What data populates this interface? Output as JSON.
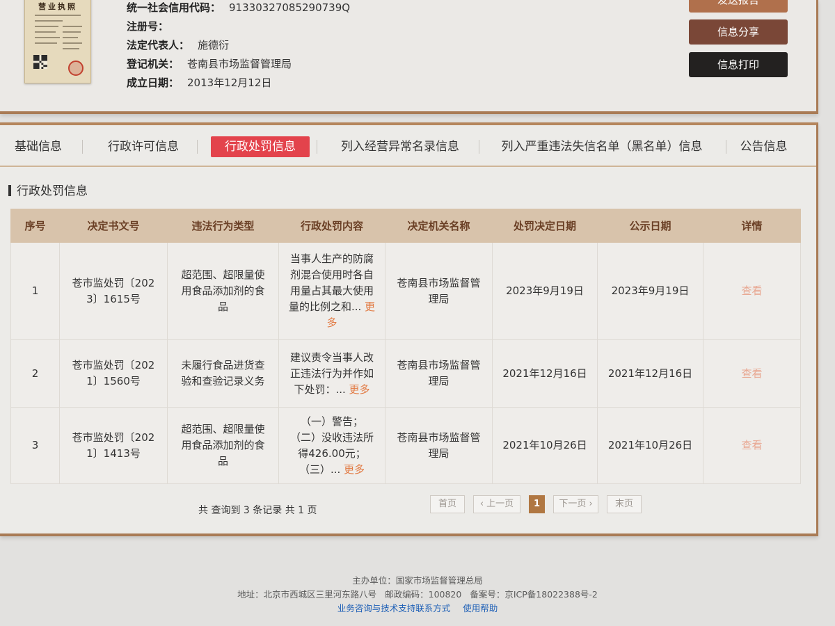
{
  "colors": {
    "tab_active": "#e3434c",
    "button_send": "#b0704c",
    "button_share": "#7a4737",
    "button_print": "#232120",
    "card_border": "#a97b55",
    "table_header_bg": "#d8c3ab",
    "more_link": "#e27a43",
    "view_link": "#e8a791",
    "page_current": "#b07742",
    "footer_link": "#1d5fb6"
  },
  "company": {
    "license_title": "营业执照",
    "fields": [
      {
        "label": "统一社会信用代码：",
        "value": "91330327085290739Q"
      },
      {
        "label": "注册号：",
        "value": ""
      },
      {
        "label": "法定代表人：",
        "value": "施德衍"
      },
      {
        "label": "登记机关：",
        "value": "苍南县市场监督管理局"
      },
      {
        "label": "成立日期：",
        "value": "2013年12月12日"
      }
    ]
  },
  "actions": {
    "send_report": "发送报告",
    "share": "信息分享",
    "print": "信息打印"
  },
  "tabs": [
    {
      "label": "基础信息",
      "active": false
    },
    {
      "label": "行政许可信息",
      "active": false
    },
    {
      "label": "行政处罚信息",
      "active": true
    },
    {
      "label": "列入经营异常名录信息",
      "active": false
    },
    {
      "label": "列入严重违法失信名单（黑名单）信息",
      "active": false
    },
    {
      "label": "公告信息",
      "active": false
    }
  ],
  "section_title": "行政处罚信息",
  "table": {
    "columns": [
      "序号",
      "决定书文号",
      "违法行为类型",
      "行政处罚内容",
      "决定机关名称",
      "处罚决定日期",
      "公示日期",
      "详情"
    ],
    "more_label": "更多",
    "view_label": "查看",
    "rows": [
      {
        "index": "1",
        "decision_number": "苍市监处罚〔2023〕1615号",
        "violation_type": "超范围、超限量使用食品添加剂的食品",
        "penalty_content": "当事人生产的防腐剂混合使用时各自用量占其最大使用量的比例之和...",
        "authority": "苍南县市场监督管理局",
        "decision_date": "2023年9月19日",
        "publish_date": "2023年9月19日"
      },
      {
        "index": "2",
        "decision_number": "苍市监处罚〔2021〕1560号",
        "violation_type": "未履行食品进货查验和查验记录义务",
        "penalty_content": "建议责令当事人改正违法行为并作如下处罚：...",
        "authority": "苍南县市场监督管理局",
        "decision_date": "2021年12月16日",
        "publish_date": "2021年12月16日"
      },
      {
        "index": "3",
        "decision_number": "苍市监处罚〔2021〕1413号",
        "violation_type": "超范围、超限量使用食品添加剂的食品",
        "penalty_content": "（一）警告；\n（二）没收违法所得426.00元；\n（三）...",
        "authority": "苍南县市场监督管理局",
        "decision_date": "2021年10月26日",
        "publish_date": "2021年10月26日"
      }
    ]
  },
  "pagination": {
    "summary": "共 查询到 3 条记录 共 1 页",
    "first": "首页",
    "prev": "‹ 上一页",
    "current": "1",
    "next": "下一页 ›",
    "last": "末页"
  },
  "footer": {
    "sponsor": "主办单位：国家市场监督管理总局",
    "address": "地址：北京市西城区三里河东路八号",
    "postcode": "邮政编码：100820",
    "icp": "备案号：京ICP备18022388号-2",
    "links": [
      "业务咨询与技术支持联系方式",
      "使用帮助"
    ]
  }
}
